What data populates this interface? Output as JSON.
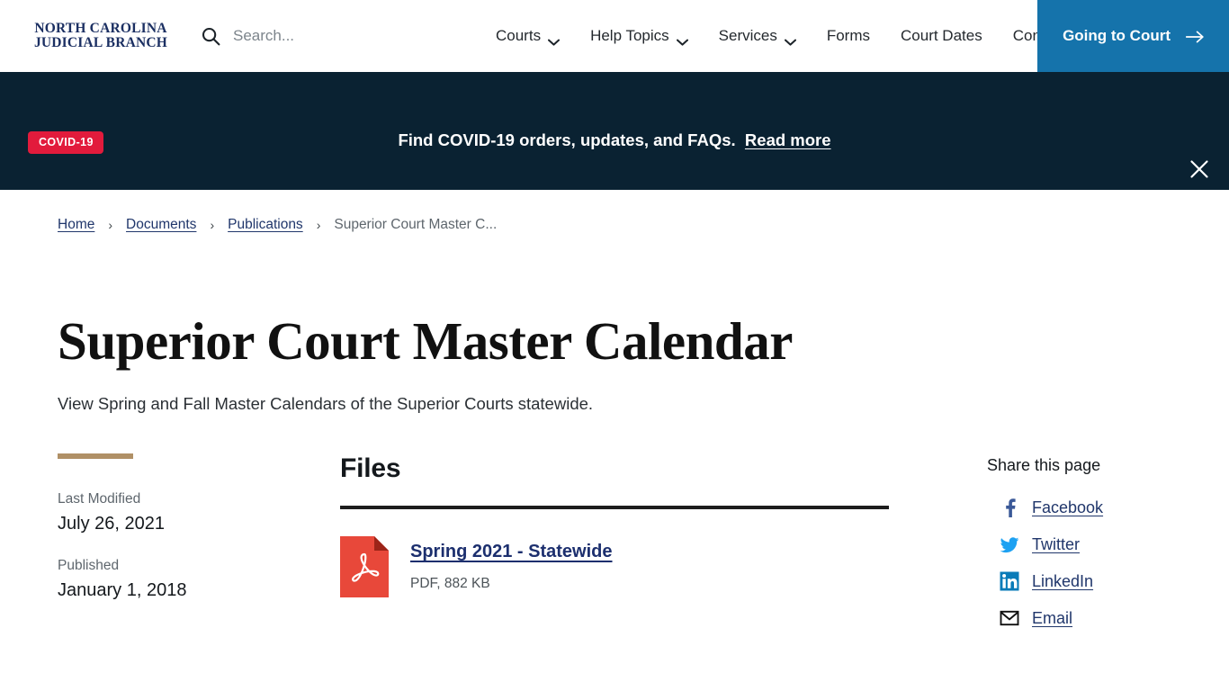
{
  "header": {
    "logo_line1": "NORTH CAROLINA",
    "logo_line2": "JUDICIAL BRANCH",
    "search_placeholder": "Search...",
    "search_value": "",
    "search_icon": "search-icon",
    "nav": [
      {
        "label": "Courts",
        "has_dropdown": true
      },
      {
        "label": "Help Topics",
        "has_dropdown": true
      },
      {
        "label": "Services",
        "has_dropdown": true
      },
      {
        "label": "Forms",
        "has_dropdown": false
      },
      {
        "label": "Court Dates",
        "has_dropdown": false
      },
      {
        "label": "Contact",
        "has_dropdown": false
      }
    ],
    "cta_label": "Going to Court",
    "cta_icon": "arrow-right-icon",
    "cta_color": "#1573ab"
  },
  "banner": {
    "badge": "COVID-19",
    "badge_color": "#e21b3c",
    "background": "#0a2232",
    "text": "Find COVID-19 orders, updates, and FAQs.",
    "link": "Read more",
    "close_icon": "close-icon"
  },
  "breadcrumb": {
    "separator": "›",
    "items": [
      {
        "label": "Home",
        "current": false
      },
      {
        "label": "Documents",
        "current": false
      },
      {
        "label": "Publications",
        "current": false
      },
      {
        "label": "Superior Court Master C...",
        "current": true
      }
    ]
  },
  "page": {
    "title": "Superior Court Master Calendar",
    "subtitle": "View Spring and Fall Master Calendars of the Superior Courts statewide.",
    "accent_color": "#b09066"
  },
  "meta": {
    "last_modified_label": "Last Modified",
    "last_modified_value": "July 26, 2021",
    "published_label": "Published",
    "published_value": "January 1, 2018"
  },
  "files": {
    "heading": "Files",
    "items": [
      {
        "icon": "pdf-file-icon",
        "name": "Spring 2021 - Statewide ",
        "meta": "PDF, 882 KB"
      }
    ]
  },
  "share": {
    "heading": "Share this page",
    "items": [
      {
        "label": "Facebook",
        "icon": "facebook-icon",
        "color": "#3b5998"
      },
      {
        "label": "Twitter",
        "icon": "twitter-icon",
        "color": "#1da1f2"
      },
      {
        "label": "LinkedIn",
        "icon": "linkedin-icon",
        "color": "#0a7bb8"
      },
      {
        "label": "Email",
        "icon": "email-icon",
        "color": "#111111"
      }
    ]
  }
}
